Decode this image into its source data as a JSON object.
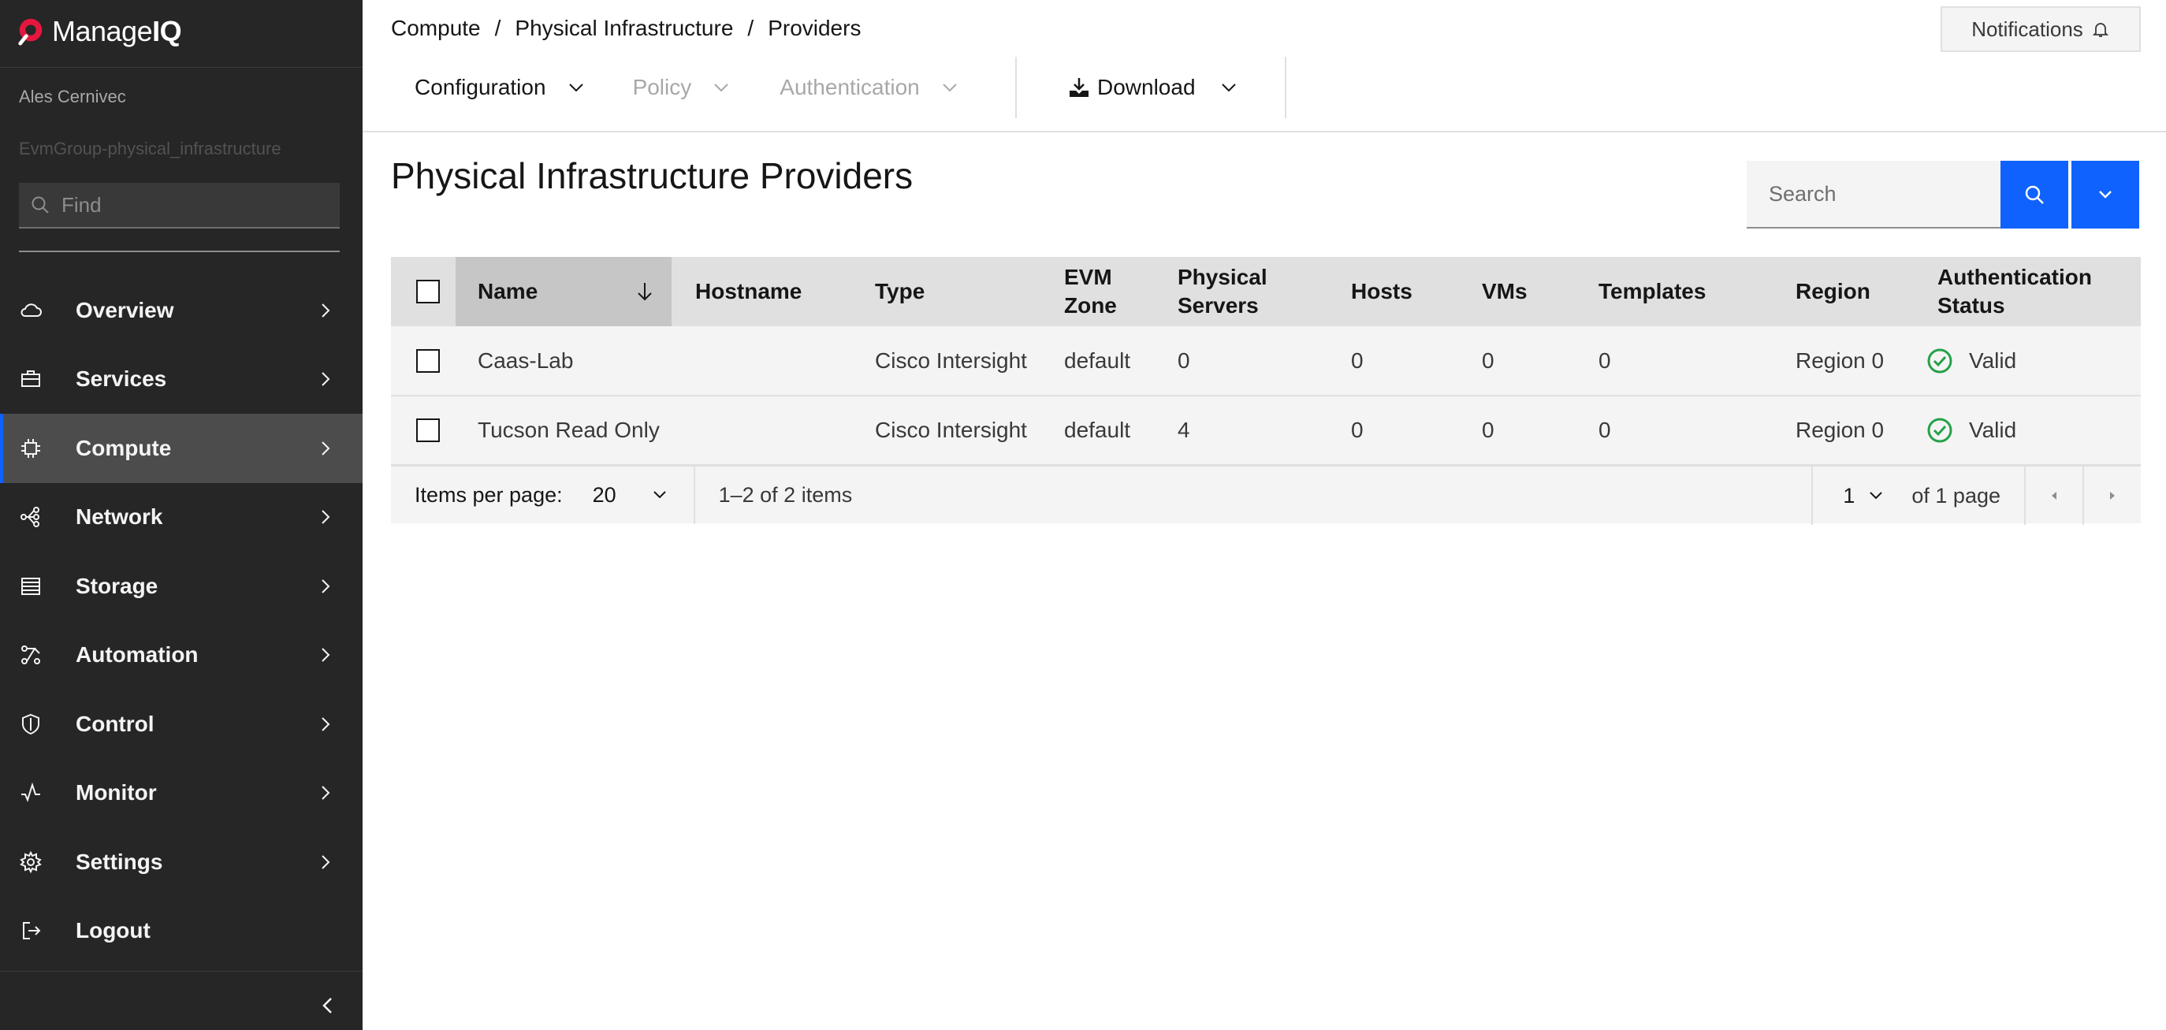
{
  "brand": {
    "name_light": "Manage",
    "name_bold": "IQ"
  },
  "user": {
    "name": "Ales Cernivec",
    "group": "EvmGroup-physical_infrastructure"
  },
  "find": {
    "placeholder": "Find"
  },
  "nav": {
    "items": [
      {
        "label": "Overview",
        "icon": "cloud-icon"
      },
      {
        "label": "Services",
        "icon": "toolbox-icon"
      },
      {
        "label": "Compute",
        "icon": "chip-icon",
        "active": true
      },
      {
        "label": "Network",
        "icon": "network-icon"
      },
      {
        "label": "Storage",
        "icon": "storage-icon"
      },
      {
        "label": "Automation",
        "icon": "automation-icon"
      },
      {
        "label": "Control",
        "icon": "shield-icon"
      },
      {
        "label": "Monitor",
        "icon": "activity-icon"
      },
      {
        "label": "Settings",
        "icon": "gear-icon"
      },
      {
        "label": "Logout",
        "icon": "logout-icon"
      }
    ]
  },
  "breadcrumb": {
    "items": [
      "Compute",
      "Physical Infrastructure",
      "Providers"
    ],
    "separator": "/"
  },
  "header": {
    "notifications_label": "Notifications"
  },
  "toolbar": {
    "configuration": "Configuration",
    "policy": "Policy",
    "authentication": "Authentication",
    "download": "Download"
  },
  "page": {
    "title": "Physical Infrastructure Providers"
  },
  "search": {
    "placeholder": "Search"
  },
  "table": {
    "columns": {
      "name": "Name",
      "hostname": "Hostname",
      "type": "Type",
      "evm_zone_1": "EVM",
      "evm_zone_2": "Zone",
      "physical_servers_1": "Physical",
      "physical_servers_2": "Servers",
      "hosts": "Hosts",
      "vms": "VMs",
      "templates": "Templates",
      "region": "Region",
      "auth_status_1": "Authentication",
      "auth_status_2": "Status"
    },
    "rows": [
      {
        "name": "Caas-Lab",
        "hostname": "",
        "type": "Cisco Intersight",
        "evm_zone": "default",
        "physical_servers": "0",
        "hosts": "0",
        "vms": "0",
        "templates": "0",
        "region": "Region 0",
        "auth_status": "Valid"
      },
      {
        "name": "Tucson Read Only",
        "hostname": "",
        "type": "Cisco Intersight",
        "evm_zone": "default",
        "physical_servers": "4",
        "hosts": "0",
        "vms": "0",
        "templates": "0",
        "region": "Region 0",
        "auth_status": "Valid"
      }
    ]
  },
  "pagination": {
    "items_per_page_label": "Items per page:",
    "items_per_page": "20",
    "range": "1–2 of 2 items",
    "page": "1",
    "of_pages": "of 1 page"
  },
  "colors": {
    "accent": "#0f62fe",
    "sidebar_bg": "#262626",
    "valid_green": "#24a148"
  }
}
